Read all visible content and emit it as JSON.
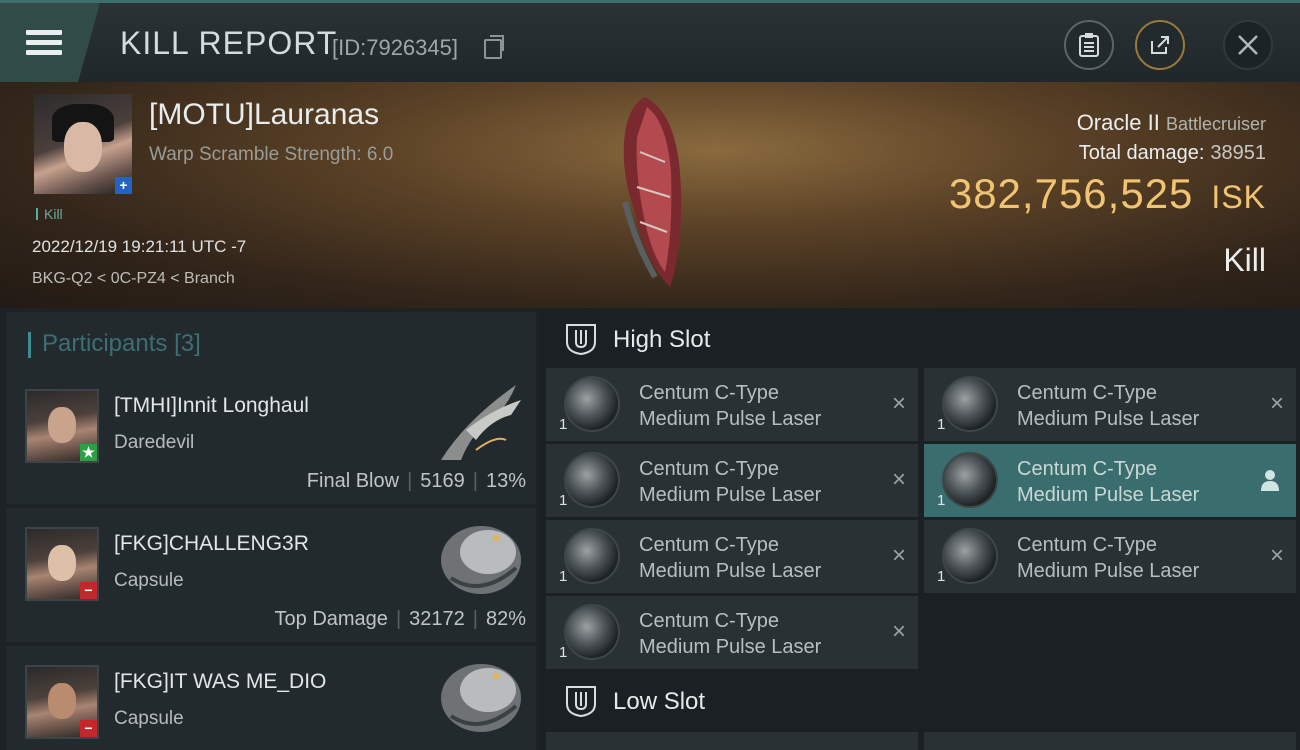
{
  "header": {
    "title": "KILL REPORT",
    "id_text": "[ID:7926345]",
    "menu_icon": "hamburger-icon",
    "buttons": [
      "clipboard-icon",
      "share-icon",
      "close-icon"
    ]
  },
  "victim": {
    "name": "[MOTU]Lauranas",
    "warp": "Warp Scramble Strength: 6.0",
    "badge": "+",
    "kill_tag": "Kill",
    "datetime": "2022/12/19 19:21:11 UTC -7",
    "location": "BKG-Q2 < 0C-PZ4 < Branch",
    "ship_name": "Oracle II",
    "ship_class": "Battlecruiser",
    "damage_label": "Total damage:",
    "damage_value": "38951",
    "isk_value": "382,756,525",
    "isk_unit": "ISK",
    "result": "Kill"
  },
  "participants": {
    "title": "Participants",
    "count": "[3]",
    "rows": [
      {
        "name": "[TMHI]Innit Longhaul",
        "ship": "Daredevil",
        "label": "Final Blow",
        "damage": "5169",
        "pct": "13%",
        "badge": "★"
      },
      {
        "name": "[FKG]CHALLENG3R",
        "ship": "Capsule",
        "label": "Top Damage",
        "damage": "32172",
        "pct": "82%",
        "badge": "−"
      },
      {
        "name": "[FKG]IT WAS ME_DIO",
        "ship": "Capsule",
        "badge": "−"
      }
    ]
  },
  "slots": {
    "high_label": "High Slot",
    "low_label": "Low Slot",
    "module_line1": "Centum C-Type",
    "module_line2": "Medium Pulse Laser",
    "qty": "1",
    "remove_icon": "×"
  },
  "colors": {
    "accent": "#3f8b92",
    "isk": "#f0c472",
    "selected": "#3a6e6e"
  }
}
